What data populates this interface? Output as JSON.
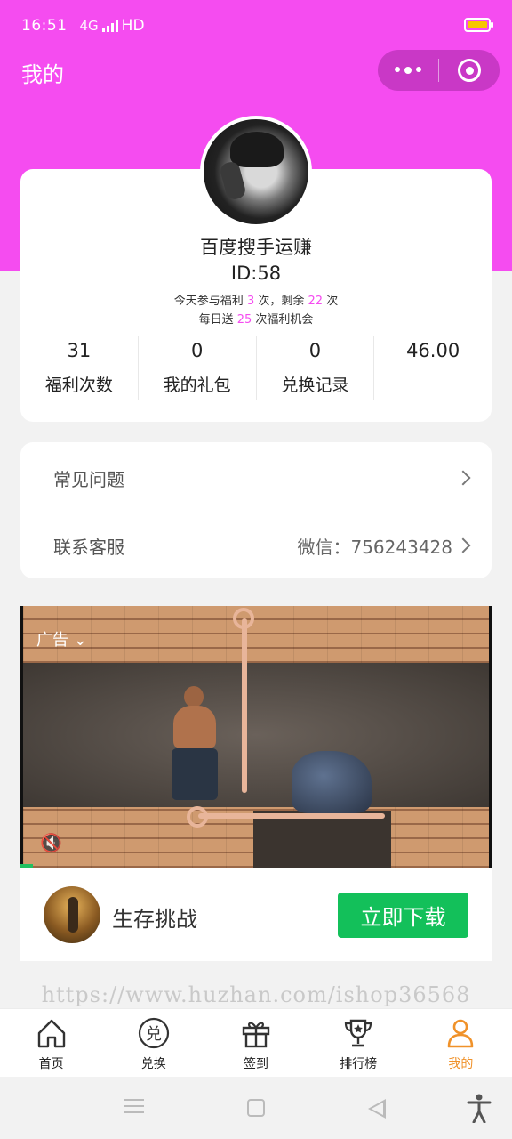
{
  "status": {
    "time": "16:51",
    "network": "4G",
    "hd": "HD"
  },
  "header": {
    "title": "我的",
    "capsule_icons": [
      "more-dots-icon",
      "target-icon"
    ]
  },
  "profile": {
    "name": "百度搜手运赚",
    "id_text": "ID:58",
    "line1": {
      "pre": "今天参与福利",
      "used": "3",
      "mid": "次，剩余",
      "left": "22",
      "post": "次"
    },
    "line2": {
      "pre": "每日送",
      "count": "25",
      "post": "次福利机会"
    },
    "stats": [
      {
        "value": "31",
        "label": "福利次数"
      },
      {
        "value": "0",
        "label": "我的礼包"
      },
      {
        "value": "0",
        "label": "兑换记录"
      },
      {
        "value": "46.00",
        "label": ""
      }
    ]
  },
  "menu": {
    "faq": "常见问题",
    "service": "联系客服",
    "service_value": "微信：756243428"
  },
  "ad": {
    "tag": "广告",
    "app_name": "生存挑战",
    "button": "立即下载"
  },
  "watermark": "https://www.huzhan.com/ishop36568",
  "tabs": [
    {
      "label": "首页",
      "icon": "home-icon"
    },
    {
      "label": "兑换",
      "icon": "exchange-icon"
    },
    {
      "label": "签到",
      "icon": "gift-icon"
    },
    {
      "label": "排行榜",
      "icon": "trophy-icon"
    },
    {
      "label": "我的",
      "icon": "user-icon",
      "active": true
    }
  ],
  "colors": {
    "brand": "#f54cf0",
    "accent": "#f0922a",
    "download": "#13c05a"
  }
}
